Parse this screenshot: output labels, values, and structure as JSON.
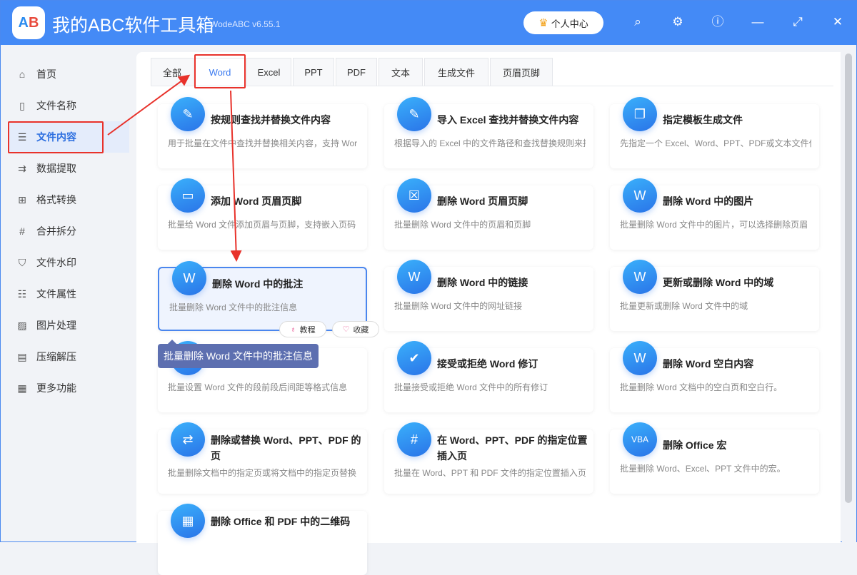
{
  "header": {
    "logo_text": "AB",
    "title": "我的ABC软件工具箱",
    "version": "WodeABC v6.55.1",
    "user_center": "个人中心"
  },
  "sidebar": {
    "items": [
      {
        "label": "首页",
        "icon": "home-icon",
        "glyph": "⌂"
      },
      {
        "label": "文件名称",
        "icon": "file-name-icon",
        "glyph": "▯"
      },
      {
        "label": "文件内容",
        "icon": "list-icon",
        "glyph": "☰"
      },
      {
        "label": "数据提取",
        "icon": "extract-icon",
        "glyph": "⇉"
      },
      {
        "label": "格式转换",
        "icon": "convert-icon",
        "glyph": "⊞"
      },
      {
        "label": "合并拆分",
        "icon": "hash-icon",
        "glyph": "#"
      },
      {
        "label": "文件水印",
        "icon": "shield-icon",
        "glyph": "⛉"
      },
      {
        "label": "文件属性",
        "icon": "properties-icon",
        "glyph": "☷"
      },
      {
        "label": "图片处理",
        "icon": "image-icon",
        "glyph": "▨"
      },
      {
        "label": "压缩解压",
        "icon": "zip-icon",
        "glyph": "▤"
      },
      {
        "label": "更多功能",
        "icon": "grid-icon",
        "glyph": "▦"
      }
    ],
    "active": "文件内容"
  },
  "tabs": [
    {
      "label": "全部"
    },
    {
      "label": "Word"
    },
    {
      "label": "Excel"
    },
    {
      "label": "PPT"
    },
    {
      "label": "PDF"
    },
    {
      "label": "文本"
    },
    {
      "label": "生成文件"
    },
    {
      "label": "页眉页脚"
    }
  ],
  "active_tab": "Word",
  "cards": [
    {
      "title": "按规则查找并替换文件内容",
      "desc": "用于批量在文件中查找并替换相关内容，支持 Wor",
      "glyph": "✎"
    },
    {
      "title": "导入 Excel 查找并替换文件内容",
      "desc": "根据导入的 Excel 中的文件路径和查找替换规则来批",
      "glyph": "✎"
    },
    {
      "title": "指定模板生成文件",
      "desc": "先指定一个 Excel、Word、PPT、PDF或文本文件作",
      "glyph": "❐"
    },
    {
      "title": "添加 Word 页眉页脚",
      "desc": "批量给 Word 文件添加页眉与页脚，支持嵌入页码",
      "glyph": "▭"
    },
    {
      "title": "删除 Word 页眉页脚",
      "desc": "批量删除 Word 文件中的页眉和页脚",
      "glyph": "☒"
    },
    {
      "title": "删除 Word 中的图片",
      "desc": "批量删除 Word 文件中的图片，可以选择删除页眉",
      "glyph": "W"
    },
    {
      "title": "删除 Word 中的批注",
      "desc": "批量删除 Word 文件中的批注信息",
      "glyph": "W"
    },
    {
      "title": "删除 Word 中的链接",
      "desc": "批量删除 Word 文件中的网址链接",
      "glyph": "W"
    },
    {
      "title": "更新或删除 Word 中的域",
      "desc": "批量更新或删除 Word 文件中的域",
      "glyph": "W"
    },
    {
      "title": "",
      "desc": "批量设置 Word 文件的段前段后间距等格式信息",
      "glyph": "W"
    },
    {
      "title": "接受或拒绝 Word 修订",
      "desc": "批量接受或拒绝 Word 文件中的所有修订",
      "glyph": "✔"
    },
    {
      "title": "删除 Word 空白内容",
      "desc": "批量删除 Word 文档中的空白页和空白行。",
      "glyph": "W"
    },
    {
      "title": "删除或替换 Word、PPT、PDF 的页",
      "desc": "批量删除文档中的指定页或将文档中的指定页替换",
      "glyph": "⇄"
    },
    {
      "title": "在 Word、PPT、PDF 的指定位置插入页",
      "desc": "批量在 Word、PPT 和 PDF 文件的指定位置插入页.",
      "glyph": "#"
    },
    {
      "title": "删除 Office 宏",
      "desc": "批量删除 Word、Excel、PPT 文件中的宏。",
      "glyph": "VBA"
    },
    {
      "title": "删除 Office 和 PDF 中的二维码",
      "desc": "",
      "glyph": "▦"
    }
  ],
  "card_actions": {
    "tutorial": "教程",
    "favorite": "收藏"
  },
  "tooltip": "批量删除 Word 文件中的批注信息",
  "colors": {
    "header": "#448af6",
    "accent": "#3a7af0",
    "annotation": "#e8322b"
  }
}
